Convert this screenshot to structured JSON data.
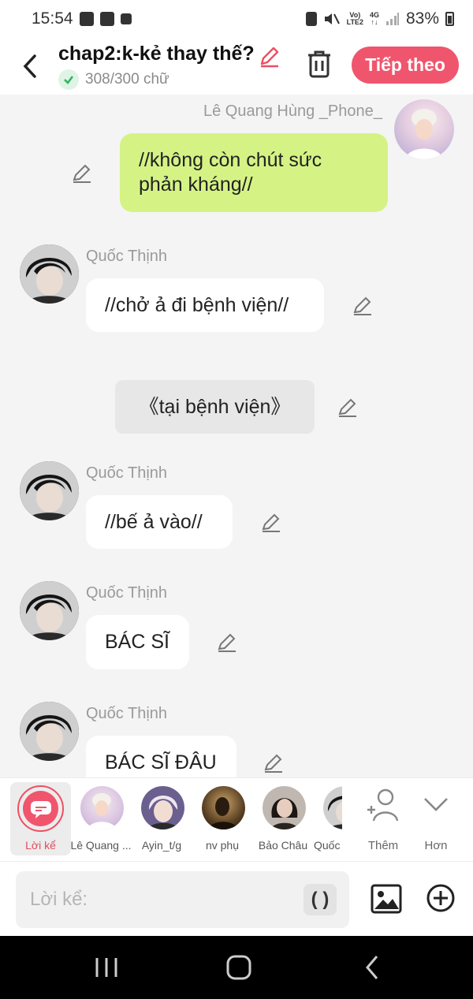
{
  "status": {
    "time": "15:54",
    "network_top": "Vo)",
    "network_bottom": "LTE2",
    "g4_top": "4G",
    "g4_bottom": "↑↓",
    "battery": "83%"
  },
  "header": {
    "title": "chap2:k-kẻ thay thế?",
    "count": "308/300 chữ",
    "next_label": "Tiếp theo"
  },
  "messages": [
    {
      "speaker": "Lê Quang Hùng _Phone_",
      "text": "//không còn chút sức phản kháng//"
    },
    {
      "speaker": "Quốc Thịnh",
      "text": "//chở ả đi bệnh viện//"
    },
    {
      "narration": "《tại bệnh viện》"
    },
    {
      "speaker": "Quốc Thịnh",
      "text": "//bế ả vào//"
    },
    {
      "speaker": "Quốc Thịnh",
      "text": "BÁC SĨ"
    },
    {
      "speaker": "Quốc Thịnh",
      "text": "BÁC SĨ ĐÂU"
    }
  ],
  "characters": [
    {
      "label": "Lời kể"
    },
    {
      "label": "Lê Quang ..."
    },
    {
      "label": "Ayin_t/g"
    },
    {
      "label": "nv phụ"
    },
    {
      "label": "Bảo Châu"
    },
    {
      "label": "Quốc"
    }
  ],
  "tools": {
    "add_label": "Thêm",
    "more_label": "Hơn"
  },
  "input": {
    "placeholder": "Lời kể:",
    "paren": "( )"
  },
  "colors": {
    "accent": "#f0556e",
    "own_bubble": "#d5f385",
    "narration_bubble": "#e7e7e7",
    "background": "#f4f4f4"
  }
}
